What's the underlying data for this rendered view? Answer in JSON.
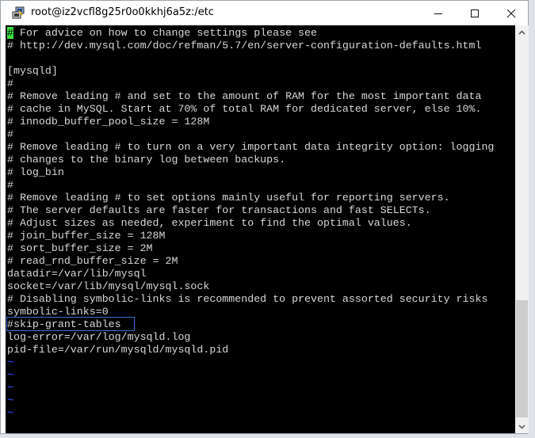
{
  "window": {
    "title": "root@iz2vcfl8g25r0o0kkhj6a5z:/etc",
    "app_icon": "putty-icon",
    "controls": {
      "minimize": "minimize-icon",
      "maximize": "maximize-icon",
      "close": "close-icon"
    }
  },
  "terminal": {
    "cursor_char": "#",
    "lines": [
      " For advice on how to change settings please see",
      "# http://dev.mysql.com/doc/refman/5.7/en/server-configuration-defaults.html",
      "",
      "[mysqld]",
      "#",
      "# Remove leading # and set to the amount of RAM for the most important data",
      "# cache in MySQL. Start at 70% of total RAM for dedicated server, else 10%.",
      "# innodb_buffer_pool_size = 128M",
      "#",
      "# Remove leading # to turn on a very important data integrity option: logging",
      "# changes to the binary log between backups.",
      "# log_bin",
      "#",
      "# Remove leading # to set options mainly useful for reporting servers.",
      "# The server defaults are faster for transactions and fast SELECTs.",
      "# Adjust sizes as needed, experiment to find the optimal values.",
      "# join_buffer_size = 128M",
      "# sort_buffer_size = 2M",
      "# read_rnd_buffer_size = 2M",
      "datadir=/var/lib/mysql",
      "socket=/var/lib/mysql/mysql.sock",
      "# Disabling symbolic-links is recommended to prevent assorted security risks",
      "symbolic-links=0",
      "#skip-grant-tables",
      "log-error=/var/log/mysqld.log",
      "pid-file=/var/run/mysqld/mysqld.pid"
    ],
    "highlighted_line": "#skip-grant-tables",
    "empty_line_marker": "~",
    "empty_line_count": 5
  },
  "scrollbar": {
    "up": "chevron-up-icon",
    "down": "chevron-down-icon",
    "position_fraction": 0.72
  },
  "colors": {
    "cursor": "#3ce03c",
    "text": "#d8d8d8",
    "tilde": "#2a3fd6",
    "highlight_border": "#3b6fd8",
    "background": "#000000"
  }
}
